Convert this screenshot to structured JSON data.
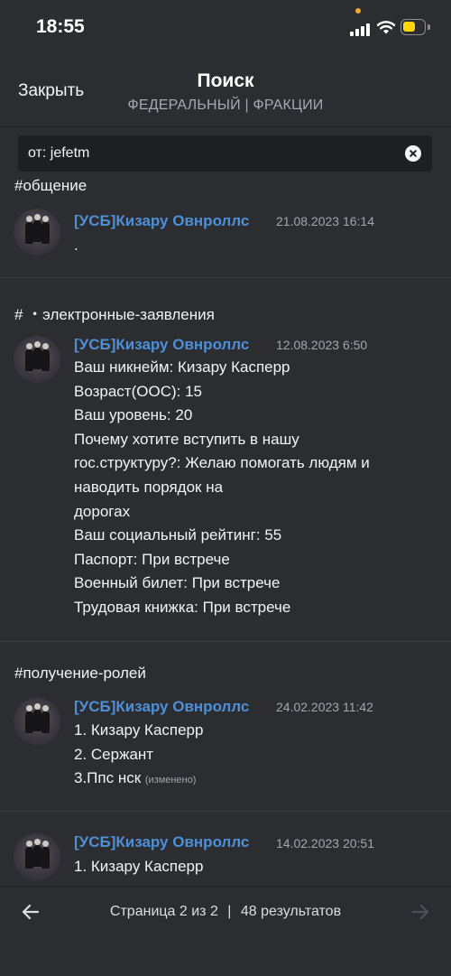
{
  "status": {
    "time": "18:55"
  },
  "header": {
    "close_label": "Закрыть",
    "title": "Поиск",
    "subtitle": "ФЕДЕРАЛЬНЫЙ | ФРАКЦИИ"
  },
  "search": {
    "query": "от: jefetm"
  },
  "results": [
    {
      "channel": "#общение",
      "author": "[УСБ]Кизару Овнроллс",
      "timestamp": "21.08.2023 16:14",
      "lines": [
        "."
      ]
    },
    {
      "channel": "# ・электронные-заявления",
      "author": "[УСБ]Кизару Овнроллс",
      "timestamp": "12.08.2023 6:50",
      "lines": [
        "Ваш никнейм: Кизару Касперр",
        "Возраст(ООС): 15",
        "Ваш уровень: 20",
        "Почему хотите вступить в нашу",
        "гос.структуру?: Желаю помогать людям и",
        "наводить порядок на",
        "дорогах",
        "Ваш социальный рейтинг: 55",
        "Паспорт: При встрече",
        "Военный билет: При встрече",
        "Трудовая книжка: При встрече"
      ]
    },
    {
      "channel": "#получение-ролей",
      "author": "[УСБ]Кизару Овнроллс",
      "timestamp": "24.02.2023 11:42",
      "lines": [
        "1. Кизару Касперр",
        "2. Сержант",
        "3.Ппс нск"
      ],
      "edited_label": "(изменено)"
    },
    {
      "author": "[УСБ]Кизару Овнроллс",
      "timestamp": "14.02.2023 20:51",
      "lines": [
        "1. Кизару Касперр"
      ]
    }
  ],
  "footer": {
    "page_text": "Страница 2 из 2",
    "separator": "|",
    "results_text": "48 результатов"
  },
  "icons": {
    "prev": "arrow-left-icon",
    "next": "arrow-right-icon",
    "clear": "clear-circle-x-icon",
    "wifi": "wifi-icon",
    "signal": "cellular-signal-icon",
    "battery": "battery-icon"
  },
  "colors": {
    "background": "#2b2d31",
    "search_background": "#1e1f22",
    "author": "#4f8fd7",
    "battery": "#ffd60a",
    "recording_dot": "#f0a732"
  }
}
